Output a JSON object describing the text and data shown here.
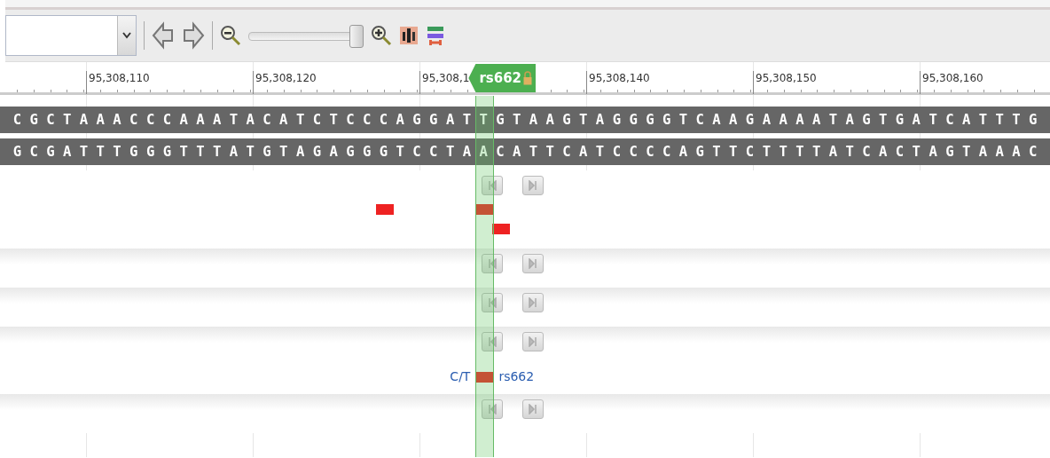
{
  "toolbar": {
    "zoom_slider": {
      "level": 0.93
    }
  },
  "ruler": {
    "ticks": [
      "95,308,110",
      "95,308,120",
      "95,308,1",
      "95,308,140",
      "95,308,150",
      "95,308,160"
    ],
    "marker": {
      "label": "rs662"
    }
  },
  "sequence": {
    "forward": "C G C T A A A C C C A A A T A C A T C T C C C A G G A T T G T A A G T A G G G G T C A A G A A A A T A G T G A T C A T T T G",
    "reverse": "G C G A T T T G G G T T T A T G T A G A G G G T C C T A A C A T T C A T C C C C A G T T C T T T T A T C A C T A G T A A A C"
  },
  "tracks": [
    {
      "kind": "features",
      "nav": true,
      "features": [
        {
          "kind": "snp"
        },
        {
          "kind": "snp"
        },
        {
          "kind": "snp"
        }
      ]
    },
    {
      "kind": "nav",
      "nav": true
    },
    {
      "kind": "nav",
      "nav": true
    },
    {
      "kind": "nav",
      "nav": true
    },
    {
      "kind": "variant",
      "nav": false,
      "alleles": "C/T",
      "id": "rs662"
    },
    {
      "kind": "nav",
      "nav": true
    }
  ]
}
